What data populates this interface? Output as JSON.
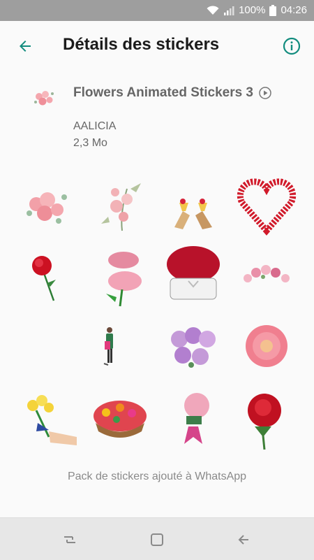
{
  "status_bar": {
    "battery": "100%",
    "time": "04:26"
  },
  "app_bar": {
    "title": "Détails des stickers",
    "back_icon": "arrow-left-icon",
    "info_icon": "info-icon"
  },
  "pack": {
    "name": "Flowers Animated Stickers 3",
    "author": "AALICIA",
    "size": "2,3 Mo"
  },
  "stickers": [
    "pink-roses-bouquet",
    "roses-branch",
    "toasting-hands",
    "rose-heart-wreath",
    "single-red-rose",
    "pink-rose-pair",
    "red-roses-hatbox",
    "rose-garland",
    "woman-with-flowers",
    "purple-roses-bunch",
    "pink-dahlia",
    "yellow-roses-hand",
    "flower-basket",
    "pink-rose-bow",
    "red-rose"
  ],
  "footer": {
    "status_text": "Pack de stickers ajouté à WhatsApp"
  },
  "colors": {
    "accent": "#128c7e",
    "status_bar": "#9e9e9e",
    "nav_bar": "#e7e7e7"
  }
}
